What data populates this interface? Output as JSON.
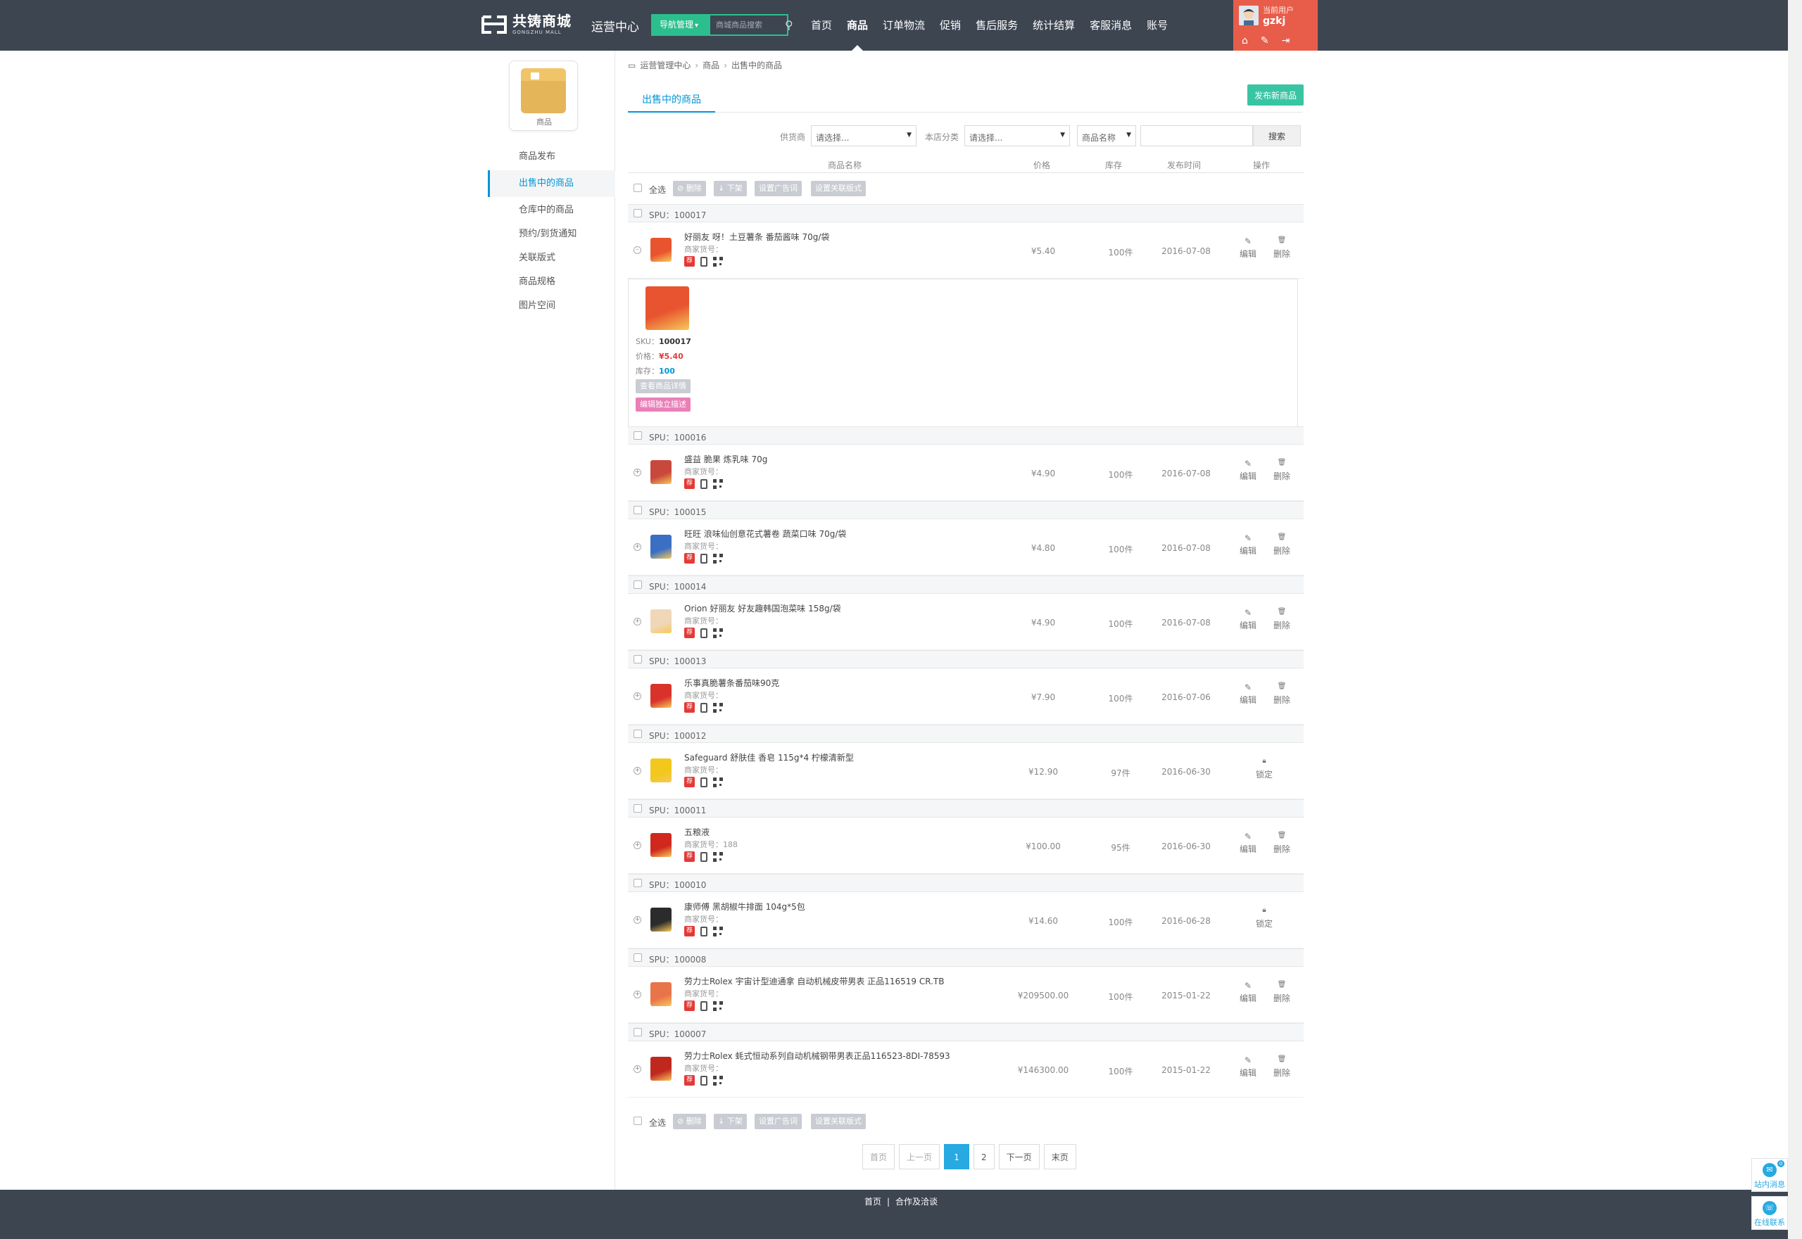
{
  "header": {
    "logo_cn": "共铸商城",
    "logo_en": "GONGZHU MALL",
    "center_title": "运营中心",
    "nav_dropdown": "导航管理",
    "search_placeholder": "商城商品搜索",
    "nav": [
      "首页",
      "商品",
      "订单物流",
      "促销",
      "售后服务",
      "统计结算",
      "客服消息",
      "账号"
    ],
    "active_nav": "商品",
    "user_label": "当前用户",
    "username": "gzkj"
  },
  "sidebar": {
    "icon_label": "商品",
    "items": [
      "商品发布",
      "出售中的商品",
      "仓库中的商品",
      "预约/到货通知",
      "关联版式",
      "商品规格",
      "图片空间"
    ],
    "active_item": "出售中的商品"
  },
  "breadcrumb": [
    "运营管理中心",
    "商品",
    "出售中的商品"
  ],
  "tab": "出售中的商品",
  "publish_button": "发布新商品",
  "filters": {
    "supplier_label": "供货商",
    "supplier_value": "请选择...",
    "category_label": "本店分类",
    "category_value": "请选择...",
    "field_value": "商品名称",
    "search_button": "搜索"
  },
  "table_headers": {
    "name": "商品名称",
    "price": "价格",
    "stock": "库存",
    "date": "发布时间",
    "ops": "操作"
  },
  "bulk": {
    "select_all": "全选",
    "delete": "删除",
    "offline": "下架",
    "ad_words": "设置广告词",
    "related_layout": "设置关联版式"
  },
  "labels": {
    "merchant_code": "商家货号：",
    "edit": "编辑",
    "delete": "删除",
    "locked": "锁定",
    "recommend": "荐"
  },
  "products": [
    {
      "spu": "SPU：100017",
      "name": "好丽友 呀！土豆薯条 番茄酱味 70g/袋",
      "code": "",
      "price": "¥5.40",
      "stock": "100件",
      "date": "2016-07-08",
      "locked": false,
      "expanded": true,
      "color": "#e8542f"
    },
    {
      "spu": "SPU：100016",
      "name": "盛益 脆果 炼乳味 70g",
      "code": "",
      "price": "¥4.90",
      "stock": "100件",
      "date": "2016-07-08",
      "locked": false,
      "expanded": false,
      "color": "#c8483c"
    },
    {
      "spu": "SPU：100015",
      "name": "旺旺 浪味仙创意花式薯卷 蔬菜口味 70g/袋",
      "code": "",
      "price": "¥4.80",
      "stock": "100件",
      "date": "2016-07-08",
      "locked": false,
      "expanded": false,
      "color": "#3a6fc4"
    },
    {
      "spu": "SPU：100014",
      "name": "Orion 好丽友 好友趣韩国泡菜味 158g/袋",
      "code": "",
      "price": "¥4.90",
      "stock": "100件",
      "date": "2016-07-08",
      "locked": false,
      "expanded": false,
      "color": "#f0d7b8"
    },
    {
      "spu": "SPU：100013",
      "name": "乐事真脆薯条番茄味90克",
      "code": "",
      "price": "¥7.90",
      "stock": "100件",
      "date": "2016-07-06",
      "locked": false,
      "expanded": false,
      "color": "#d9322b"
    },
    {
      "spu": "SPU：100012",
      "name": "Safeguard 舒肤佳 香皂 115g*4 柠檬清新型",
      "code": "",
      "price": "¥12.90",
      "stock": "97件",
      "date": "2016-06-30",
      "locked": true,
      "expanded": false,
      "color": "#f2c81c"
    },
    {
      "spu": "SPU：100011",
      "name": "五粮液",
      "code": "188",
      "price": "¥100.00",
      "stock": "95件",
      "date": "2016-06-30",
      "locked": false,
      "expanded": false,
      "color": "#d0281e"
    },
    {
      "spu": "SPU：100010",
      "name": "康师傅 黑胡椒牛排面 104g*5包",
      "code": "",
      "price": "¥14.60",
      "stock": "100件",
      "date": "2016-06-28",
      "locked": true,
      "expanded": false,
      "color": "#2b2b2b"
    },
    {
      "spu": "SPU：100008",
      "name": "劳力士Rolex 宇宙计型迪通拿 自动机械皮带男表 正品116519 CR.TB",
      "code": "",
      "price": "¥209500.00",
      "stock": "100件",
      "date": "2015-01-22",
      "locked": false,
      "expanded": false,
      "color": "#e9744a"
    },
    {
      "spu": "SPU：100007",
      "name": "劳力士Rolex 蚝式恒动系列自动机械钢带男表正品116523-8DI-78593",
      "code": "",
      "price": "¥146300.00",
      "stock": "100件",
      "date": "2015-01-22",
      "locked": false,
      "expanded": false,
      "color": "#c0281e"
    }
  ],
  "sku_detail": {
    "sku_label": "SKU：",
    "sku": "100017",
    "price_label": "价格：",
    "price": "¥5.40",
    "stock_label": "库存：",
    "stock": "100",
    "view_button": "查看商品详情",
    "edit_button": "编辑独立描述"
  },
  "pager": [
    "首页",
    "上一页",
    "1",
    "2",
    "下一页",
    "末页"
  ],
  "pager_current": "1",
  "footer": [
    "首页",
    "合作及洽谈"
  ],
  "widgets": {
    "messages": "站内消息",
    "messages_count": "0",
    "online": "在线联系"
  },
  "colors": {
    "header_bg": "#3d4551",
    "accent_green": "#2cbf8e",
    "user_bg": "#e85d4a",
    "link_blue": "#0096d6",
    "publish_bg": "#39c5a3"
  }
}
